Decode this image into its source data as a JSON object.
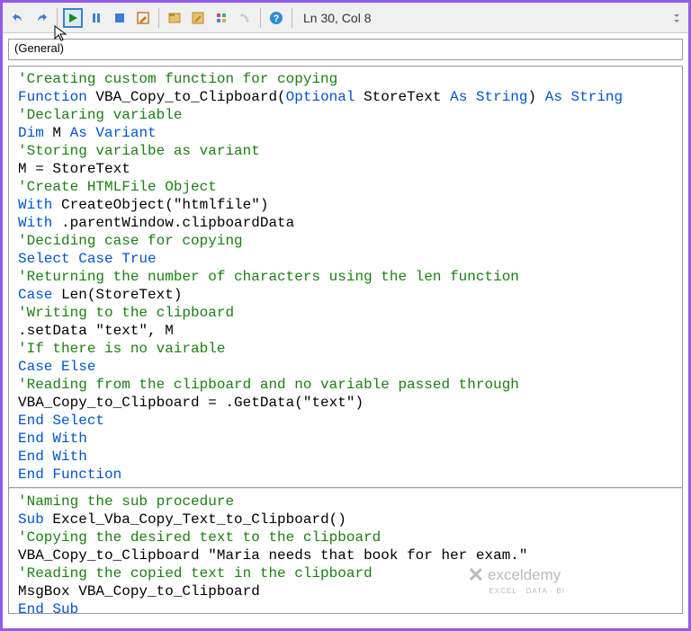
{
  "toolbar": {
    "status": "Ln 30, Col 8",
    "icons": [
      {
        "name": "undo-icon"
      },
      {
        "name": "redo-icon"
      },
      {
        "name": "run-icon",
        "selected": true,
        "color": "#1a8a1a"
      },
      {
        "name": "pause-icon",
        "color": "#3b7fd4"
      },
      {
        "name": "stop-icon",
        "color": "#3b7fd4"
      },
      {
        "name": "design-icon"
      },
      {
        "name": "project-icon"
      },
      {
        "name": "properties-icon"
      },
      {
        "name": "object-icon"
      },
      {
        "name": "toolbox-icon"
      },
      {
        "name": "help-icon",
        "color": "#2b8ed4"
      }
    ]
  },
  "dropdown": {
    "label": "(General)"
  },
  "code1": [
    [
      {
        "t": "'Creating custom function for copying",
        "c": "cm"
      }
    ],
    [
      {
        "t": "Function",
        "c": "kw"
      },
      {
        "t": " VBA_Copy_to_Clipboard(",
        "c": "pl"
      },
      {
        "t": "Optional",
        "c": "kw"
      },
      {
        "t": " StoreText ",
        "c": "pl"
      },
      {
        "t": "As String",
        "c": "kw"
      },
      {
        "t": ") ",
        "c": "pl"
      },
      {
        "t": "As String",
        "c": "kw"
      }
    ],
    [
      {
        "t": "'Declaring variable",
        "c": "cm"
      }
    ],
    [
      {
        "t": "Dim",
        "c": "kw"
      },
      {
        "t": " M ",
        "c": "pl"
      },
      {
        "t": "As Variant",
        "c": "kw"
      }
    ],
    [
      {
        "t": "'Storing varialbe as variant",
        "c": "cm"
      }
    ],
    [
      {
        "t": "M = StoreText",
        "c": "pl"
      }
    ],
    [
      {
        "t": "'Create HTMLFile Object",
        "c": "cm"
      }
    ],
    [
      {
        "t": "With",
        "c": "kw"
      },
      {
        "t": " CreateObject(\"htmlfile\")",
        "c": "pl"
      }
    ],
    [
      {
        "t": "With",
        "c": "kw"
      },
      {
        "t": " .parentWindow.clipboardData",
        "c": "pl"
      }
    ],
    [
      {
        "t": "'Deciding case for copying",
        "c": "cm"
      }
    ],
    [
      {
        "t": "Select Case True",
        "c": "kw"
      }
    ],
    [
      {
        "t": "'Returning the number of characters using the len function",
        "c": "cm"
      }
    ],
    [
      {
        "t": "Case",
        "c": "kw"
      },
      {
        "t": " Len(StoreText)",
        "c": "pl"
      }
    ],
    [
      {
        "t": "'Writing to the clipboard",
        "c": "cm"
      }
    ],
    [
      {
        "t": ".setData \"text\", M",
        "c": "pl"
      }
    ],
    [
      {
        "t": "'If there is no vairable",
        "c": "cm"
      }
    ],
    [
      {
        "t": "Case Else",
        "c": "kw"
      }
    ],
    [
      {
        "t": "'Reading from the clipboard and no variable passed through",
        "c": "cm"
      }
    ],
    [
      {
        "t": "VBA_Copy_to_Clipboard = .GetData(\"text\")",
        "c": "pl"
      }
    ],
    [
      {
        "t": "End Select",
        "c": "kw"
      }
    ],
    [
      {
        "t": "End With",
        "c": "kw"
      }
    ],
    [
      {
        "t": "End With",
        "c": "kw"
      }
    ],
    [
      {
        "t": "End Function",
        "c": "kw"
      }
    ]
  ],
  "code2": [
    [
      {
        "t": "'Naming the sub procedure",
        "c": "cm"
      }
    ],
    [
      {
        "t": "Sub",
        "c": "kw"
      },
      {
        "t": " Excel_Vba_Copy_Text_to_Clipboard()",
        "c": "pl"
      }
    ],
    [
      {
        "t": "'Copying the desired text to the clipboard",
        "c": "cm"
      }
    ],
    [
      {
        "t": "VBA_Copy_to_Clipboard \"Maria needs that book for her exam.\"",
        "c": "pl"
      }
    ],
    [
      {
        "t": "'Reading the copied text in the clipboard",
        "c": "cm"
      }
    ],
    [
      {
        "t": "MsgBox VBA_Copy_to_Clipboard",
        "c": "pl"
      }
    ],
    [
      {
        "t": "End Sub",
        "c": "kw"
      }
    ]
  ],
  "watermark": {
    "brand": "exceldemy",
    "sub": "EXCEL · DATA · BI"
  }
}
